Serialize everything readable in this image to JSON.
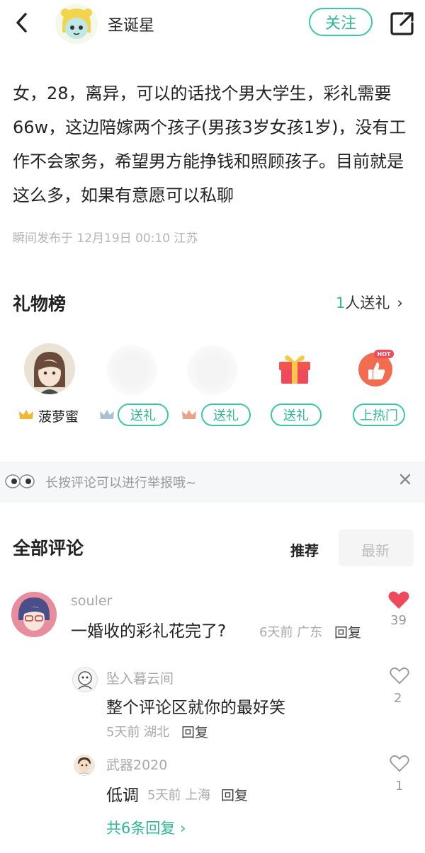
{
  "header": {
    "username": "圣诞星",
    "follow_label": "关注",
    "back_icon": "chevron-left-icon",
    "share_icon": "share-external-icon"
  },
  "post": {
    "text": "女，28，离异，可以的话找个男大学生，彩礼需要66w，这边陪嫁两个孩子(男孩3岁女孩1岁)，没有工作不会家务，希望男方能挣钱和照顾孩子。目前就是这么多，如果有意愿可以私聊",
    "meta": "瞬间发布于 12月19日 00:10 江苏"
  },
  "gifts": {
    "title": "礼物榜",
    "count_num": "1",
    "count_text": "人送礼",
    "chevron": "›",
    "gifter_name": "菠萝蜜",
    "send_label_1": "送礼",
    "send_label_2": "送礼",
    "send_label_3": "送礼",
    "hot_label": "上热门",
    "hot_badge": "HOT"
  },
  "notice": {
    "text": "长按评论可以进行举报哦~"
  },
  "comments": {
    "title": "全部评论",
    "tab_recommended": "推荐",
    "tab_latest": "最新",
    "items": [
      {
        "name": "souler",
        "text": "一婚收的彩礼花完了?",
        "meta": "6天前 广东",
        "reply": "回复",
        "likes": "39",
        "liked": true
      }
    ],
    "replies": [
      {
        "name": "坠入暮云间",
        "text": "整个评论区就你的最好笑",
        "meta": "5天前 湖北",
        "reply": "回复",
        "likes": "2"
      },
      {
        "name": "武器2020",
        "text": "低调",
        "meta": "5天前 上海",
        "reply": "回复",
        "likes": "1"
      }
    ],
    "more_replies": "共6条回复"
  },
  "colors": {
    "accent": "#2fb895",
    "heart": "#ef4a5c"
  }
}
